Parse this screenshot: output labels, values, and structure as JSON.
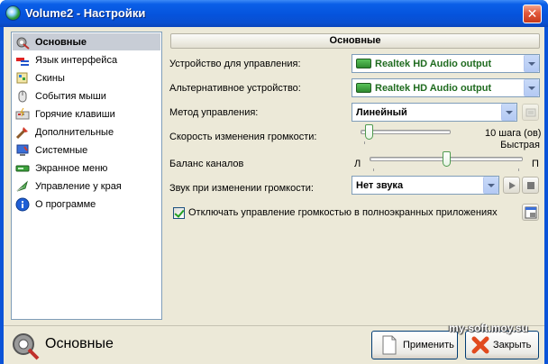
{
  "window": {
    "title": "Volume2 - Настройки",
    "close_glyph": "✕"
  },
  "sidebar": {
    "items": [
      {
        "label": "Основные",
        "icon": "general-settings-icon",
        "selected": true
      },
      {
        "label": "Язык интерфейса",
        "icon": "language-icon"
      },
      {
        "label": "Скины",
        "icon": "skins-icon"
      },
      {
        "label": "События мыши",
        "icon": "mouse-icon"
      },
      {
        "label": "Горячие клавиши",
        "icon": "hotkeys-icon"
      },
      {
        "label": "Дополнительные",
        "icon": "tools-icon"
      },
      {
        "label": "Системные",
        "icon": "system-icon"
      },
      {
        "label": "Экранное меню",
        "icon": "osd-icon"
      },
      {
        "label": "Управление у края",
        "icon": "edge-control-icon"
      },
      {
        "label": "О программе",
        "icon": "info-icon"
      }
    ]
  },
  "main": {
    "section_title": "Основные",
    "device": {
      "label": "Устройство для управления:",
      "value": "Realtek HD Audio output"
    },
    "alt_device": {
      "label": "Альтернативное устройство:",
      "value": "Realtek HD Audio output"
    },
    "method": {
      "label": "Метод управления:",
      "value": "Линейный"
    },
    "speed": {
      "label": "Скорость изменения громкости:",
      "value_text": "10 шага (ов)",
      "speed_text": "Быстрая",
      "level": 0.05
    },
    "balance": {
      "label": "Баланс каналов",
      "left": "Л",
      "right": "П",
      "level": 0.5
    },
    "sound": {
      "label": "Звук при изменении громкости:",
      "value": "Нет звука"
    },
    "fullscreen": {
      "label": "Отключать управление громкостью в полноэкранных приложениях",
      "checked": true
    }
  },
  "footer": {
    "title": "Основные",
    "apply_label": "Применить",
    "close_label": "Закрыть"
  },
  "watermark": "my-soft.moy.su",
  "colors": {
    "title_bar": "#0553dc",
    "client": "#ece9d8",
    "accent_green": "#1f6b1f",
    "close_red": "#e2583a"
  }
}
